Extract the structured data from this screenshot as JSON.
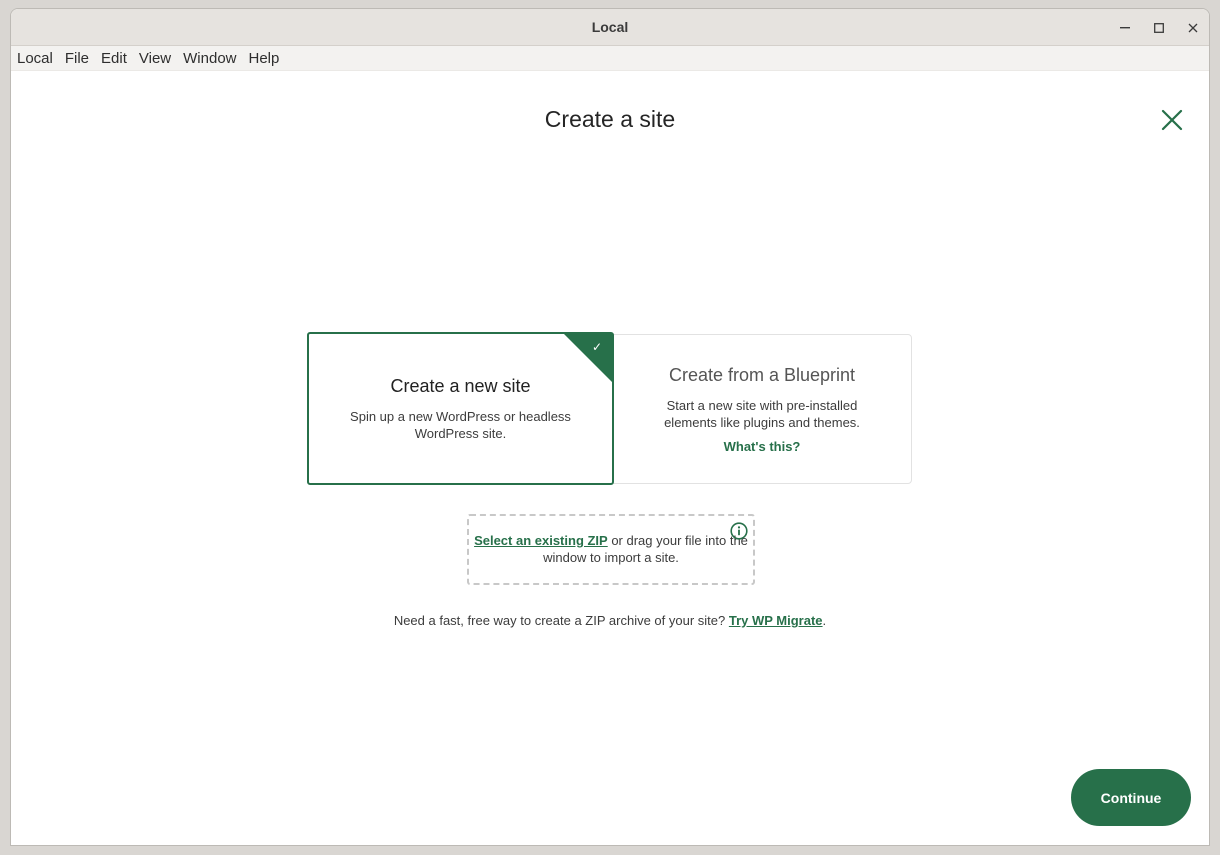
{
  "window": {
    "title": "Local",
    "controls": {
      "minimize_icon": "minimize-icon",
      "maximize_icon": "maximize-icon",
      "close_icon": "close-icon"
    }
  },
  "menubar": {
    "items": [
      {
        "label": "Local"
      },
      {
        "label": "File"
      },
      {
        "label": "Edit"
      },
      {
        "label": "View"
      },
      {
        "label": "Window"
      },
      {
        "label": "Help"
      }
    ]
  },
  "page": {
    "title": "Create a site",
    "close_icon": "close-x-icon"
  },
  "options": {
    "new_site": {
      "title": "Create a new site",
      "description": "Spin up a new WordPress or headless WordPress site.",
      "selected": true
    },
    "blueprint": {
      "title": "Create from a Blueprint",
      "description": "Start a new site with pre-installed elements like plugins and themes.",
      "link": "What's this?"
    }
  },
  "import": {
    "link": "Select an existing ZIP",
    "text_after_link": " or drag your file into the window to import a site.",
    "info_icon": "info-icon"
  },
  "hint": {
    "text": "Need a fast, free way to create a ZIP archive of your site? ",
    "link": "Try WP Migrate",
    "suffix": "."
  },
  "footer": {
    "continue_label": "Continue"
  },
  "colors": {
    "accent": "#27704a",
    "text": "#222222",
    "border": "#e2e2e2"
  }
}
